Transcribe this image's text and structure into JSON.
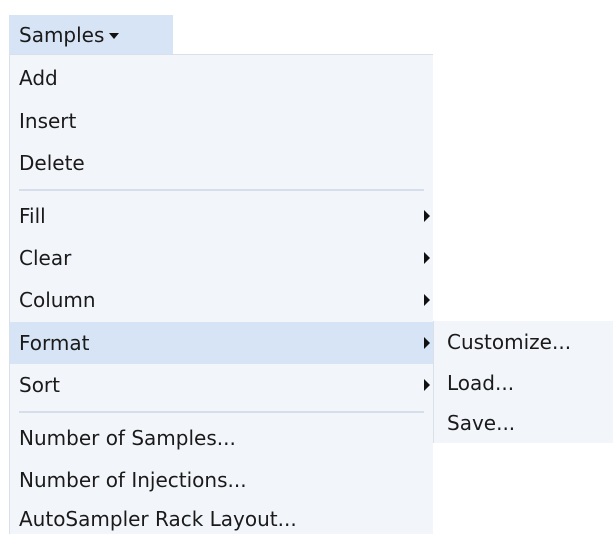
{
  "menu": {
    "title": "Samples",
    "groups": [
      {
        "items": [
          "Add",
          "Insert",
          "Delete"
        ]
      },
      {
        "items": [
          "Fill",
          "Clear",
          "Column",
          "Format",
          "Sort"
        ],
        "highlighted": "Format"
      },
      {
        "items": [
          "Number of Samples...",
          "Number of Injections...",
          "AutoSampler Rack Layout..."
        ]
      }
    ]
  },
  "submenu": {
    "parent": "Format",
    "items": [
      "Customize...",
      "Load...",
      "Save..."
    ]
  },
  "colors": {
    "highlight": "#d6e4f5",
    "menu_background": "#f2f5fa",
    "separator": "#d5deea"
  },
  "icons": {
    "title_caret": "caret-down-icon",
    "submenu_arrow": "submenu-arrow-icon"
  }
}
